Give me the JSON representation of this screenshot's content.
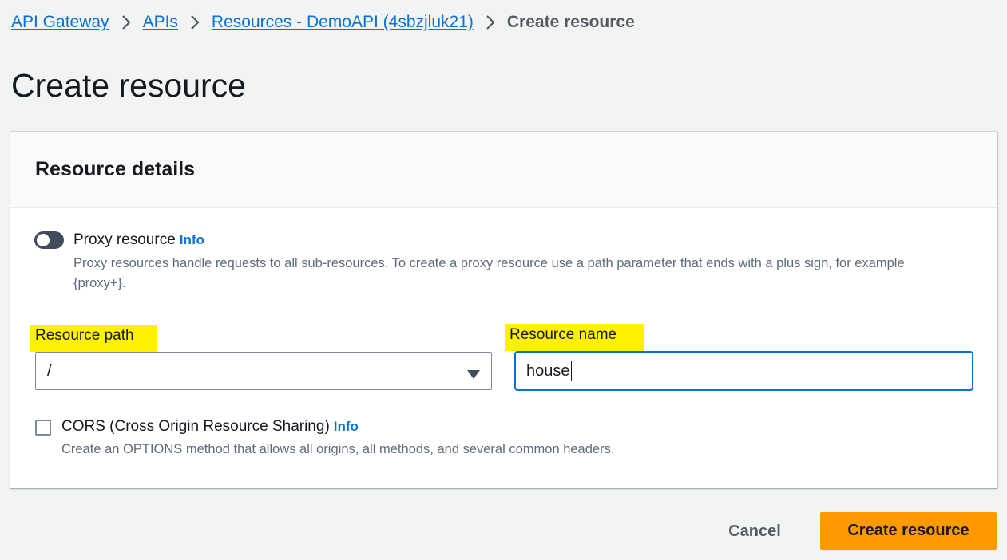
{
  "breadcrumbs": {
    "items": [
      "API Gateway",
      "APIs",
      "Resources - DemoAPI (4sbzjluk21)"
    ],
    "current": "Create resource"
  },
  "page": {
    "title": "Create resource"
  },
  "panel": {
    "title": "Resource details",
    "proxy": {
      "label": "Proxy resource",
      "info": "Info",
      "enabled": false,
      "description": "Proxy resources handle requests to all sub-resources. To create a proxy resource use a path parameter that ends with a plus sign, for example {proxy+}."
    },
    "resource_path": {
      "label": "Resource path",
      "value": "/"
    },
    "resource_name": {
      "label": "Resource name",
      "value": "house"
    },
    "cors": {
      "label": "CORS (Cross Origin Resource Sharing)",
      "info": "Info",
      "checked": false,
      "description": "Create an OPTIONS method that allows all origins, all methods, and several common headers."
    }
  },
  "actions": {
    "cancel": "Cancel",
    "submit": "Create resource"
  },
  "colors": {
    "link": "#0972d3",
    "primary_button": "#ff9900",
    "highlight": "#fff200",
    "toggle_off": "#414d5c"
  }
}
